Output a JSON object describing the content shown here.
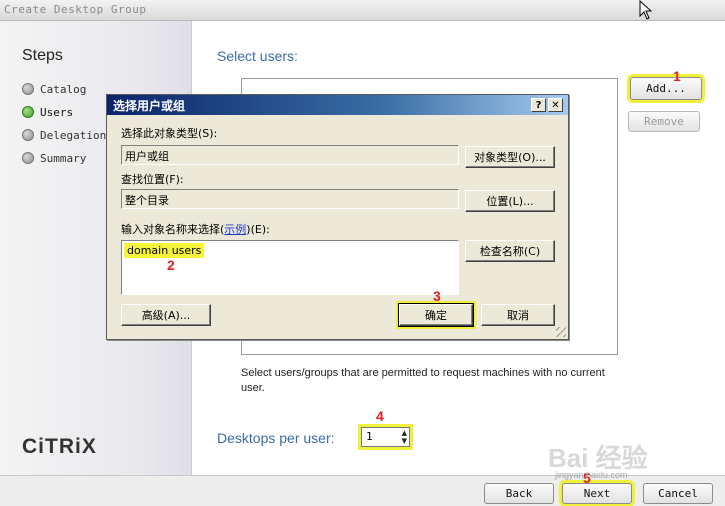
{
  "window": {
    "title": "Create Desktop Group"
  },
  "steps": {
    "heading": "Steps",
    "items": [
      {
        "label": "Catalog",
        "state": "done"
      },
      {
        "label": "Users",
        "state": "current"
      },
      {
        "label": "Delegation",
        "state": "pending"
      },
      {
        "label": "Summary",
        "state": "pending"
      }
    ]
  },
  "brand": {
    "logo_text": "CiTRiX"
  },
  "main": {
    "select_users_label": "Select users:",
    "add_label": "Add...",
    "remove_label": "Remove",
    "help_text": "Select users/groups that are permitted to request machines with no current user.",
    "desktops_per_user_label": "Desktops per user:",
    "desktops_per_user_value": "1"
  },
  "footer": {
    "back_label": "Back",
    "next_label": "Next",
    "cancel_label": "Cancel"
  },
  "dialog": {
    "title": "选择用户或组",
    "help_btn": "?",
    "close_btn": "✕",
    "object_type_label": "选择此对象类型(S):",
    "object_type_value": "用户或组",
    "object_types_button": "对象类型(O)...",
    "location_label": "查找位置(F):",
    "location_value": "整个目录",
    "location_button": "位置(L)...",
    "enter_names_label_prefix": "输入对象名称来选择(",
    "enter_names_link": "示例",
    "enter_names_label_suffix": ")(E):",
    "typed_value": "domain users",
    "check_names_button": "检查名称(C)",
    "advanced_button": "高级(A)...",
    "ok_button": "确定",
    "cancel_button": "取消"
  },
  "annotations": {
    "m1": "1",
    "m2": "2",
    "m3": "3",
    "m4": "4",
    "m5": "5"
  },
  "watermark": {
    "text": "Bai 经验",
    "sub": "jingyan.baidu.com"
  },
  "colors": {
    "accent_blue": "#3a6ea5",
    "highlight_yellow": "#f0ef3a",
    "marker_red": "#e02020",
    "dialog_title_start": "#0a246a"
  }
}
